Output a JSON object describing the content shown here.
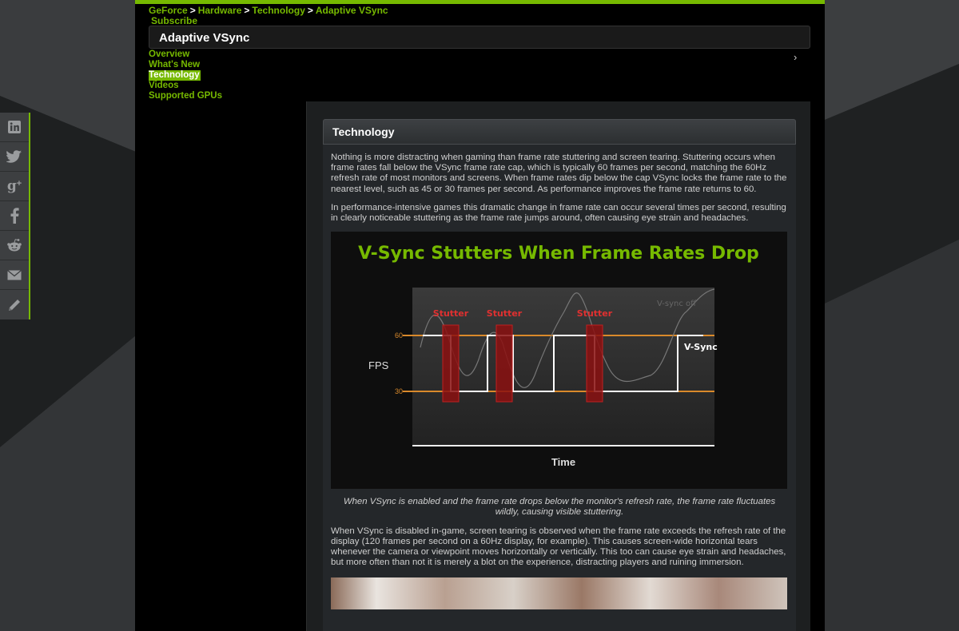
{
  "breadcrumb": [
    "GeForce",
    "Hardware",
    "Technology",
    "Adaptive VSync"
  ],
  "breadcrumb_sep": ">",
  "subscribe_label": "Subscribe",
  "page_title": "Adaptive VSync",
  "subnav": [
    {
      "label": "Overview",
      "active": false
    },
    {
      "label": "What's New",
      "active": false
    },
    {
      "label": "Technology",
      "active": true
    },
    {
      "label": "Videos",
      "active": false
    },
    {
      "label": "Supported GPUs",
      "active": false
    }
  ],
  "chevron_icon": "chevron-right-icon",
  "panel_title": "Technology",
  "paragraphs": [
    "Nothing is more distracting when gaming than frame rate stuttering and screen tearing. Stuttering occurs when frame rates fall below the VSync frame rate cap, which is typically 60 frames per second, matching the 60Hz refresh rate of most monitors and screens. When frame rates dip below the cap VSync locks the frame rate to the nearest level, such as 45 or 30 frames per second. As performance improves the frame rate returns to 60.",
    "In performance-intensive games this dramatic change in frame rate can occur several times per second, resulting in clearly noticeable stuttering as the frame rate jumps around, often causing eye strain and headaches."
  ],
  "figure": {
    "title": "V-Sync Stutters When Frame Rates Drop",
    "ylabel": "FPS",
    "xlabel": "Time",
    "tick_60": "60",
    "tick_30": "30",
    "stutter_label": "Stutter",
    "vsync_off_label": "V-sync off",
    "vsync_on_label": "V-Sync",
    "colors": {
      "title": "#76b900",
      "stutter": "#e03030",
      "ref_line": "#d9892b"
    }
  },
  "caption": "When VSync is enabled and the frame rate drops below the monitor's refresh rate, the frame rate fluctuates wildly, causing visible stuttering.",
  "paragraph_after": "When VSync is disabled in-game, screen tearing is observed when the frame rate exceeds the refresh rate of the display (120 frames per second on a 60Hz display, for example). This causes screen-wide horizontal tears whenever the camera or viewpoint moves horizontally or vertically. This too can cause eye strain and headaches, but more often than not it is merely a blot on the experience, distracting players and ruining immersion.",
  "social": [
    "linkedin-icon",
    "twitter-icon",
    "google-plus-icon",
    "facebook-icon",
    "reddit-icon",
    "email-icon",
    "pencil-icon"
  ],
  "colors": {
    "accent": "#76b900",
    "background": "#000000"
  }
}
